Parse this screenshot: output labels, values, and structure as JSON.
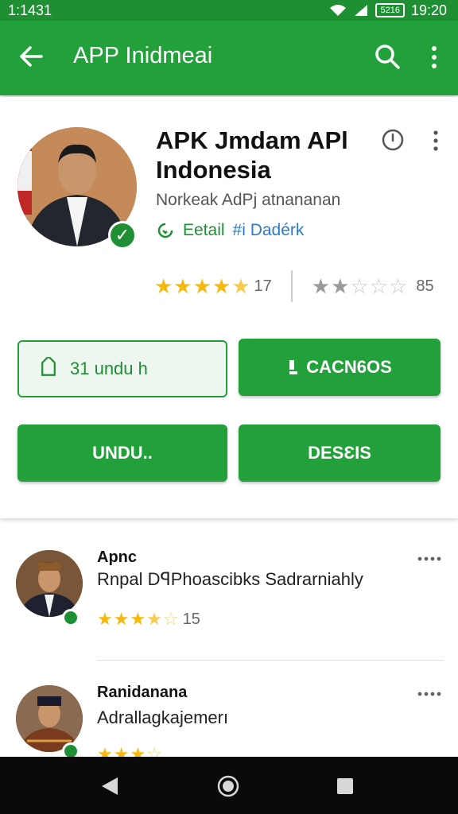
{
  "status_bar": {
    "time_left": "1:1431",
    "battery": "5216",
    "time_right": "19:20"
  },
  "app_bar": {
    "title": "APP Inidmeai"
  },
  "app": {
    "name": "APK Jmdam APl Indonesia",
    "publisher": "Norkeak AdPj atnananan",
    "verified_label": "Eetail",
    "link_label": "#i Dadérk",
    "rating_left_value": "17",
    "rating_right_value": "85"
  },
  "buttons": {
    "download_count": "31 undu h",
    "primary_action": "CACN6OS",
    "undu": "UNDU..",
    "deseis": "DESƐIS"
  },
  "reviews": [
    {
      "name": "Apnc",
      "text": "Rnpal DꟼPhoascibks Sadrarniahly",
      "rating": "15"
    },
    {
      "name": "Ranidanana",
      "text": "Adrallagkajemerı",
      "rating": ""
    }
  ],
  "colors": {
    "brand_green": "#22a03a",
    "status_green": "#1e8f33",
    "star": "#f5b90f",
    "link_blue": "#2a7bc8"
  }
}
